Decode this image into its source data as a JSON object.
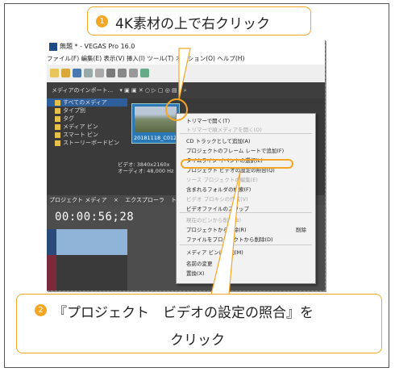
{
  "callout1": {
    "badge": "1",
    "text": "4K素材の上で右クリック"
  },
  "callout2": {
    "badge": "2",
    "line1": "『プロジェクト　ビデオの設定の照合』を",
    "line2": "クリック"
  },
  "window": {
    "title": "無題 * - VEGAS Pro 16.0"
  },
  "menu": [
    "ファイル(F)",
    "編集(E)",
    "表示(V)",
    "挿入(I)",
    "ツール(T)",
    "オプション(O)",
    "ヘルプ(H)"
  ],
  "toolbar2": {
    "label": "メディアのインポート..."
  },
  "tree": [
    "すべてのメディア",
    "タイプ別",
    "タグ",
    "メディア ビン",
    "スマート ビン",
    "ストーリーボードビン"
  ],
  "thumb": {
    "label": "20181118_C0128..."
  },
  "props": {
    "video": "ビデオ: 3840x2160x",
    "audio": "オーディオ: 48,000 Hz"
  },
  "tabs": [
    "プロジェクト メディア",
    "×",
    "エクスプローラ",
    "トラ"
  ],
  "timecode": "00:00:56;28",
  "context_menu": {
    "items": [
      {
        "label": "トリマーで開く(T)",
        "enabled": true
      },
      {
        "label": "トリマーで順メディアを開く(O)",
        "enabled": false
      },
      {
        "label": "CD トラックとして追加(A)",
        "enabled": true
      },
      {
        "label": "プロジェクトのフレーム レートで追加(F)",
        "enabled": true
      },
      {
        "label": "タイムライン イベントの選択(L)",
        "enabled": true
      },
      {
        "label": "プロジェクト ビデオの設定の照合(Q)",
        "enabled": true
      },
      {
        "label": "ソース プロジェクトの編集(E)",
        "enabled": false
      },
      {
        "label": "含まれるフォルダの検索(F)",
        "enabled": true
      },
      {
        "label": "ビデオ プロキシの作成(V)",
        "enabled": false
      },
      {
        "label": "ビデオファイルのスワップ",
        "enabled": true
      },
      {
        "label": "現在のビンから削除(B)",
        "enabled": false
      },
      {
        "label": "プロジェクトから削除(R)",
        "enabled": true
      },
      {
        "label": "ファイルをプロジェクトから削除(D)",
        "enabled": true
      },
      {
        "label": "メディア ビンに追加(M)",
        "enabled": true
      },
      {
        "label": "名前の変更",
        "enabled": true
      },
      {
        "label": "置換(X)",
        "enabled": true
      }
    ],
    "right_labels": {
      "delete": "削除",
      "nashi": "なし"
    }
  }
}
